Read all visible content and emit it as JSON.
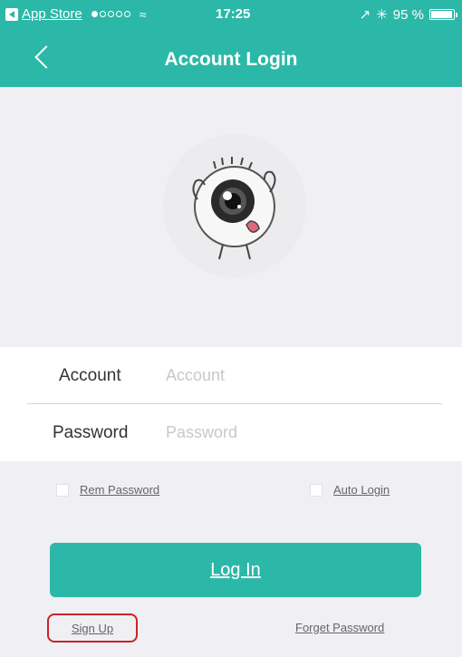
{
  "status_bar": {
    "back_app": "App Store",
    "time": "17:25",
    "battery": "95 %",
    "battery_level": 0.95
  },
  "nav": {
    "title": "Account Login"
  },
  "form": {
    "account_label": "Account",
    "account_placeholder": "Account",
    "password_label": "Password",
    "password_placeholder": "Password"
  },
  "options": {
    "remember_label": "Rem Password",
    "auto_login_label": "Auto Login"
  },
  "buttons": {
    "login": "Log In",
    "sign_up": "Sign Up",
    "forget_password": "Forget Password"
  },
  "colors": {
    "accent": "#2cb8a8",
    "background": "#efeff4",
    "highlight": "#c8232c"
  },
  "icons": {
    "avatar": "eyeball-mascot-icon",
    "back": "chevron-left-icon"
  }
}
